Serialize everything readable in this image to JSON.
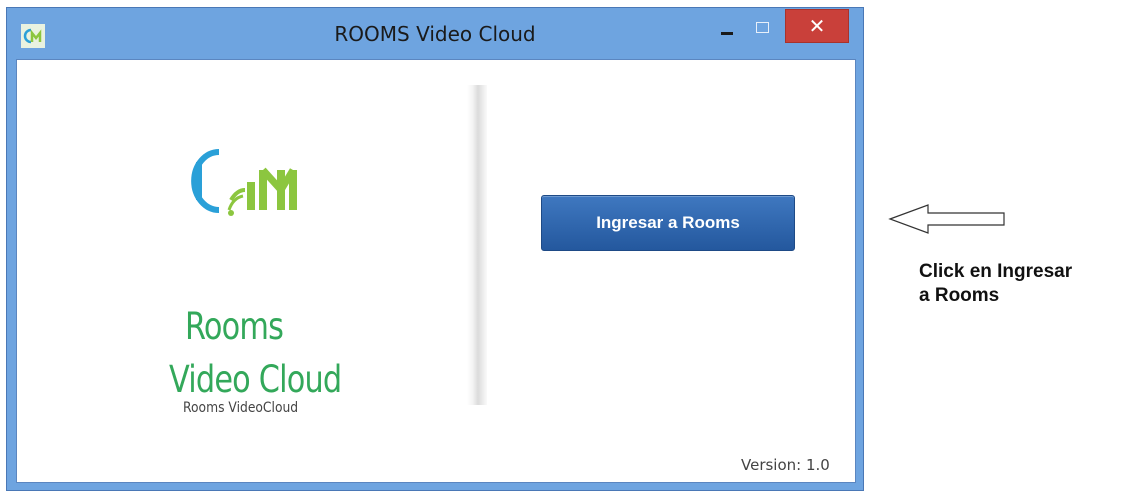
{
  "window": {
    "title": "ROOMS Video Cloud",
    "app_icon": "rooms-logo-icon",
    "controls": {
      "minimize_icon": "minimize-icon",
      "maximize_icon": "maximize-icon",
      "close_label": "✕"
    }
  },
  "brand": {
    "logo_icon": "cm-logo-icon",
    "line1": "Rooms",
    "line2": "Video Cloud",
    "caption": "Rooms VideoCloud",
    "color": "#33a85a",
    "logo_blue": "#2aa0d8",
    "logo_green": "#8cc63f"
  },
  "main": {
    "login_button": "Ingresar a Rooms",
    "button_color": "#2c62aa",
    "version": "Version: 1.0"
  },
  "annotation": {
    "arrow_icon": "left-arrow-icon",
    "line1": "Click en Ingresar",
    "line2": "a Rooms"
  }
}
